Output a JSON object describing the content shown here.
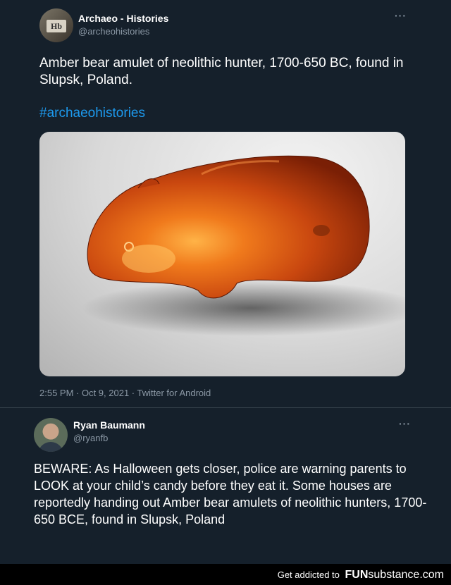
{
  "tweet1": {
    "author_name": "Archaeo - Histories",
    "author_handle": "@archeohistories",
    "avatar_text": "Hb",
    "more_label": "···",
    "text": "Amber bear amulet of neolithic hunter, 1700-650 BC, found in Slupsk, Poland.",
    "hashtag": "#archaeohistories",
    "image_alt": "amber-bear-amulet-photo",
    "meta": "2:55 PM · Oct 9, 2021 · Twitter for Android"
  },
  "tweet2": {
    "author_name": "Ryan Baumann",
    "author_handle": "@ryanfb",
    "more_label": "···",
    "text": "BEWARE: As Halloween gets closer, police are warning parents to LOOK at your child’s candy before they eat it. Some houses are reportedly handing out Amber bear amulets of neolithic hunters, 1700-650 BCE, found in Slupsk, Poland"
  },
  "footer": {
    "text": "Get addicted to",
    "brand_bold": "FUN",
    "brand_rest": "substance",
    "brand_tld": ".com"
  },
  "colors": {
    "background": "#15202b",
    "link": "#1d9bf0",
    "muted": "#8b98a5",
    "amber": "#c9470f"
  }
}
